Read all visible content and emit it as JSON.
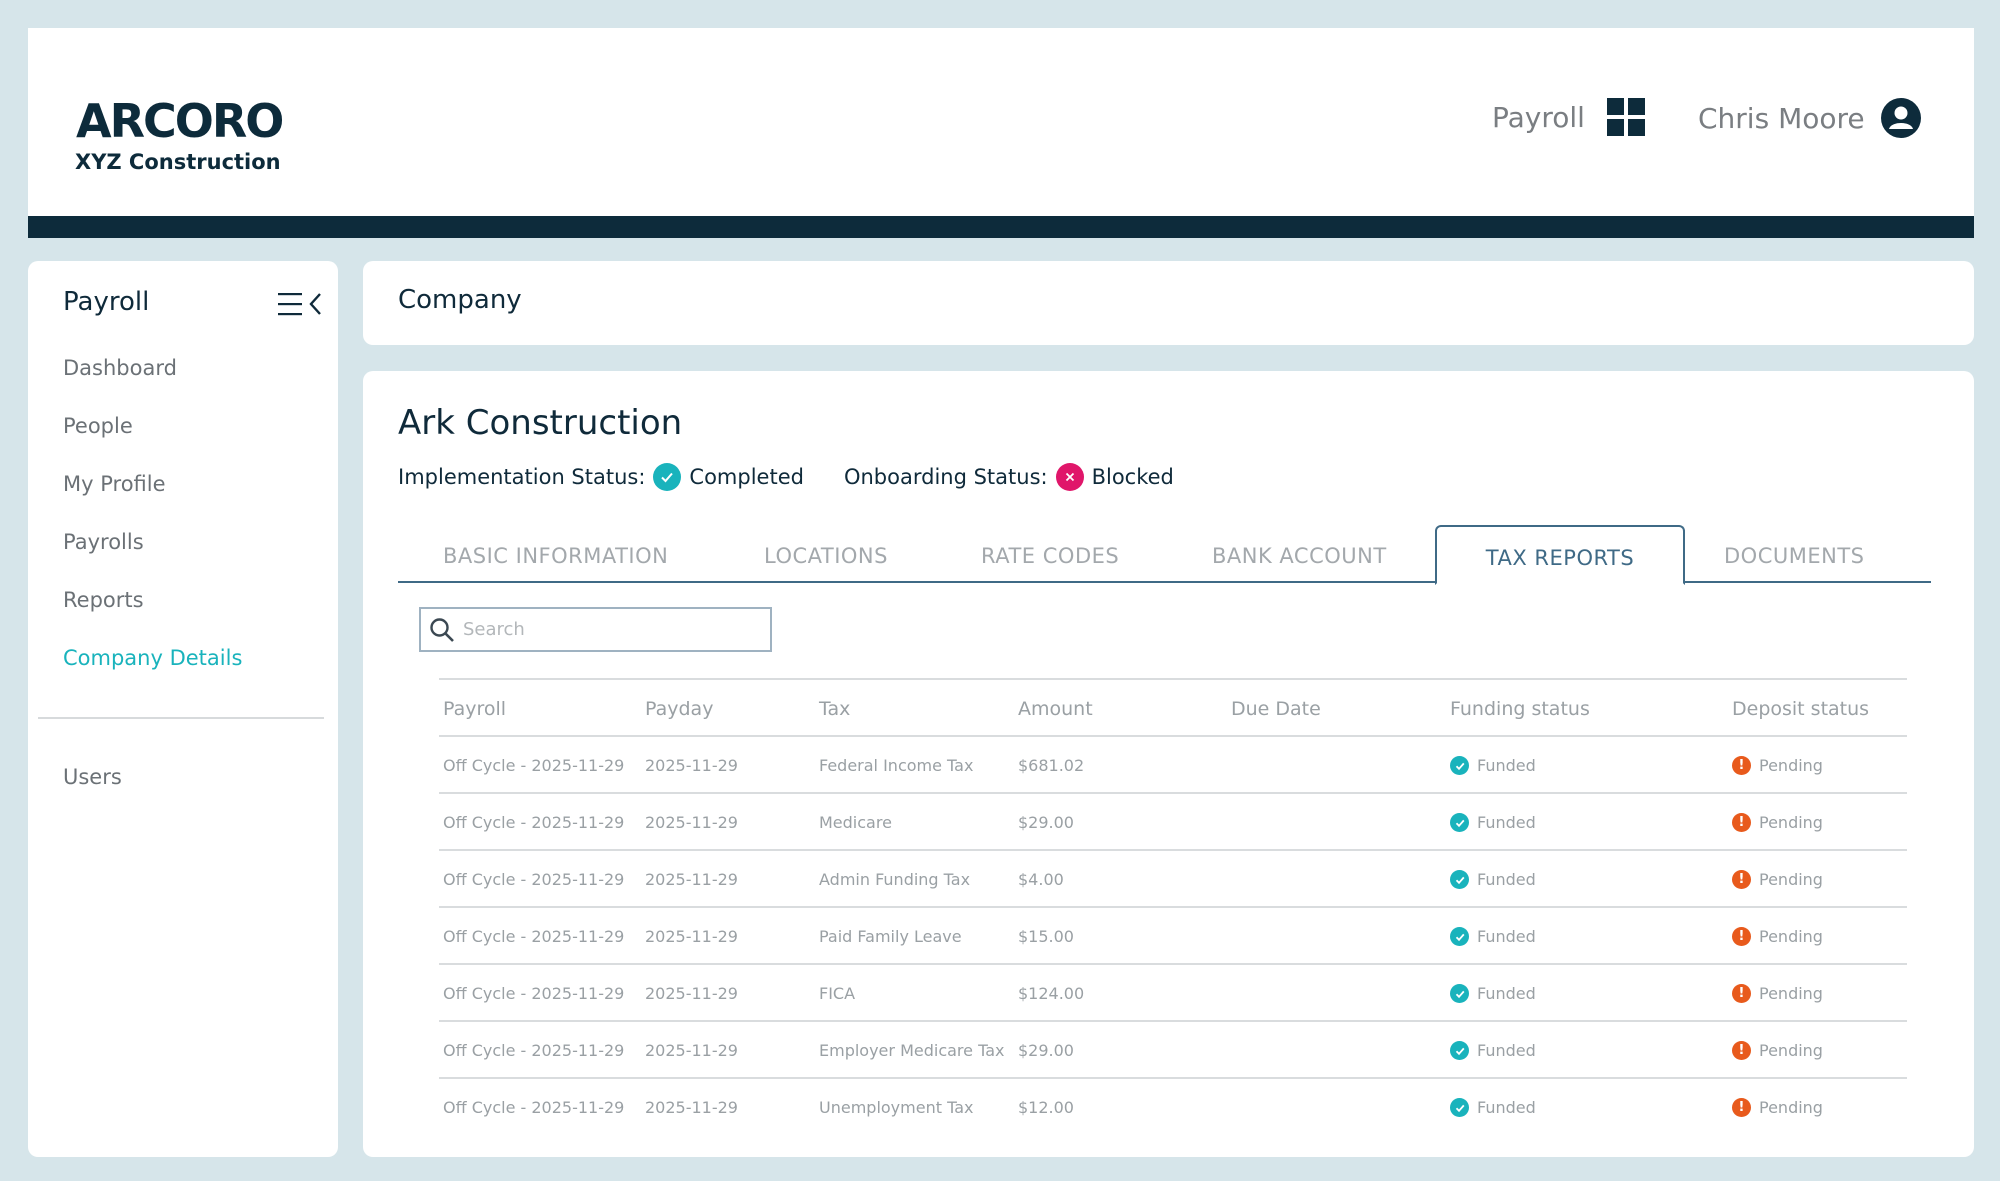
{
  "header": {
    "logo": "ARCORO",
    "company": "XYZ Construction",
    "app_label": "Payroll",
    "user_name": "Chris Moore"
  },
  "sidebar": {
    "title": "Payroll",
    "items": [
      {
        "label": "Dashboard"
      },
      {
        "label": "People"
      },
      {
        "label": "My Profile"
      },
      {
        "label": "Payrolls"
      },
      {
        "label": "Reports"
      },
      {
        "label": "Company Details"
      }
    ],
    "users_label": "Users"
  },
  "page": {
    "title": "Company"
  },
  "org": {
    "name": "Ark Construction",
    "impl_label": "Implementation Status:",
    "impl_value": "Completed",
    "onboard_label": "Onboarding Status:",
    "onboard_value": "Blocked"
  },
  "tabs": [
    {
      "label": "BASIC INFORMATION"
    },
    {
      "label": "LOCATIONS"
    },
    {
      "label": "RATE CODES"
    },
    {
      "label": "BANK ACCOUNT"
    },
    {
      "label": "TAX REPORTS"
    },
    {
      "label": "DOCUMENTS"
    }
  ],
  "search": {
    "placeholder": "Search"
  },
  "table": {
    "headers": [
      "Payroll",
      "Payday",
      "Tax",
      "Amount",
      "Due Date",
      "Funding status",
      "Deposit status"
    ],
    "rows": [
      {
        "payroll": "Off Cycle - 2025-11-29",
        "payday": "2025-11-29",
        "tax": "Federal Income Tax",
        "amount": "$681.02",
        "due": "",
        "funding": "Funded",
        "deposit": "Pending"
      },
      {
        "payroll": "Off Cycle - 2025-11-29",
        "payday": "2025-11-29",
        "tax": "Medicare",
        "amount": "$29.00",
        "due": "",
        "funding": "Funded",
        "deposit": "Pending"
      },
      {
        "payroll": "Off Cycle - 2025-11-29",
        "payday": "2025-11-29",
        "tax": "Admin Funding Tax",
        "amount": "$4.00",
        "due": "",
        "funding": "Funded",
        "deposit": "Pending"
      },
      {
        "payroll": "Off Cycle - 2025-11-29",
        "payday": "2025-11-29",
        "tax": "Paid Family Leave",
        "amount": "$15.00",
        "due": "",
        "funding": "Funded",
        "deposit": "Pending"
      },
      {
        "payroll": "Off Cycle - 2025-11-29",
        "payday": "2025-11-29",
        "tax": "FICA",
        "amount": "$124.00",
        "due": "",
        "funding": "Funded",
        "deposit": "Pending"
      },
      {
        "payroll": "Off Cycle - 2025-11-29",
        "payday": "2025-11-29",
        "tax": "Employer Medicare Tax",
        "amount": "$29.00",
        "due": "",
        "funding": "Funded",
        "deposit": "Pending"
      },
      {
        "payroll": "Off Cycle - 2025-11-29",
        "payday": "2025-11-29",
        "tax": "Unemployment Tax",
        "amount": "$12.00",
        "due": "",
        "funding": "Funded",
        "deposit": "Pending"
      }
    ]
  },
  "colors": {
    "brand_navy": "#0d2b3b",
    "accent_teal": "#19b3bc",
    "blocked_pink": "#e0166a",
    "pending_orange": "#e85a1c",
    "tab_active": "#3f6a86"
  },
  "icons": {
    "app_grid": "grid-icon",
    "user": "user-circle-icon",
    "menu": "menu-collapse-icon",
    "search": "search-icon",
    "completed": "check-circle-icon",
    "blocked": "x-circle-icon",
    "funded": "check-circle-icon",
    "pending": "exclamation-circle-icon"
  }
}
